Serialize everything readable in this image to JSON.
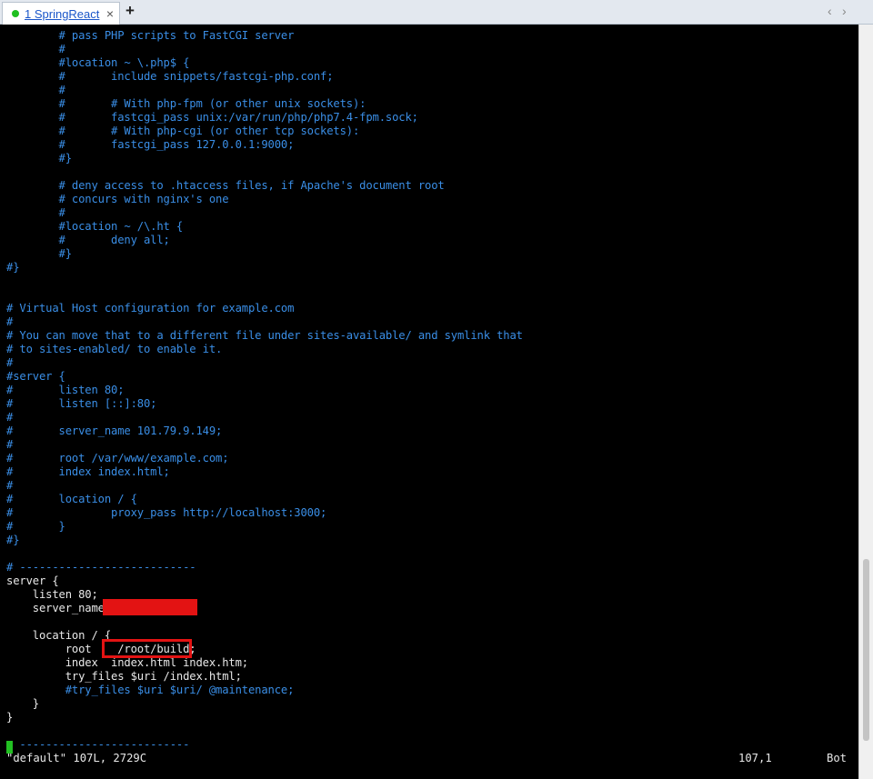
{
  "tab": {
    "label": "1 SpringReact",
    "status_color": "#1fbf1f",
    "close": "×"
  },
  "toolbar": {
    "add": "+",
    "prev": "‹",
    "next": "›"
  },
  "lines": [
    {
      "text": "        # pass PHP scripts to FastCGI server",
      "style": "c"
    },
    {
      "text": "        #",
      "style": "c"
    },
    {
      "text": "        #location ~ \\.php$ {",
      "style": "c"
    },
    {
      "text": "        #       include snippets/fastcgi-php.conf;",
      "style": "c"
    },
    {
      "text": "        #",
      "style": "c"
    },
    {
      "text": "        #       # With php-fpm (or other unix sockets):",
      "style": "c"
    },
    {
      "text": "        #       fastcgi_pass unix:/var/run/php/php7.4-fpm.sock;",
      "style": "c"
    },
    {
      "text": "        #       # With php-cgi (or other tcp sockets):",
      "style": "c"
    },
    {
      "text": "        #       fastcgi_pass 127.0.0.1:9000;",
      "style": "c"
    },
    {
      "text": "        #}",
      "style": "c"
    },
    {
      "text": "",
      "style": "c"
    },
    {
      "text": "        # deny access to .htaccess files, if Apache's document root",
      "style": "c"
    },
    {
      "text": "        # concurs with nginx's one",
      "style": "c"
    },
    {
      "text": "        #",
      "style": "c"
    },
    {
      "text": "        #location ~ /\\.ht {",
      "style": "c"
    },
    {
      "text": "        #       deny all;",
      "style": "c"
    },
    {
      "text": "        #}",
      "style": "c"
    },
    {
      "text": "#}",
      "style": "c"
    },
    {
      "text": "",
      "style": "c"
    },
    {
      "text": "",
      "style": "c"
    },
    {
      "text": "# Virtual Host configuration for example.com",
      "style": "c"
    },
    {
      "text": "#",
      "style": "c"
    },
    {
      "text": "# You can move that to a different file under sites-available/ and symlink that",
      "style": "c"
    },
    {
      "text": "# to sites-enabled/ to enable it.",
      "style": "c"
    },
    {
      "text": "#",
      "style": "c"
    },
    {
      "text": "#server {",
      "style": "c"
    },
    {
      "text": "#       listen 80;",
      "style": "c"
    },
    {
      "text": "#       listen [::]:80;",
      "style": "c"
    },
    {
      "text": "#",
      "style": "c"
    },
    {
      "text": "#       server_name 101.79.9.149;",
      "style": "c"
    },
    {
      "text": "#",
      "style": "c"
    },
    {
      "text": "#       root /var/www/example.com;",
      "style": "c"
    },
    {
      "text": "#       index index.html;",
      "style": "c"
    },
    {
      "text": "#",
      "style": "c"
    },
    {
      "text": "#       location / {",
      "style": "c"
    },
    {
      "text": "#               proxy_pass http://localhost:3000;",
      "style": "c"
    },
    {
      "text": "#       }",
      "style": "c"
    },
    {
      "text": "#}",
      "style": "c"
    },
    {
      "text": "",
      "style": "c"
    },
    {
      "text": "# ---------------------------",
      "style": "c"
    },
    {
      "text": "server {",
      "style": "w"
    },
    {
      "text": "    listen 80;",
      "style": "w"
    },
    {
      "text": "    server_name",
      "style": "w"
    },
    {
      "text": "",
      "style": "w"
    },
    {
      "text": "    location / {",
      "style": "w"
    },
    {
      "text": "         root    /root/build;",
      "style": "w"
    },
    {
      "text": "         index  index.html index.htm;",
      "style": "w"
    },
    {
      "text": "         try_files $uri /index.html;",
      "style": "w"
    },
    {
      "text": "         #try_files $uri $uri/ @maintenance;",
      "style": "c"
    },
    {
      "text": "    }",
      "style": "w"
    },
    {
      "text": "}",
      "style": "w"
    },
    {
      "text": "",
      "style": "w"
    },
    {
      "text": "  --------------------------",
      "style": "c"
    }
  ],
  "status": {
    "left": "\"default\" 107L, 2729C",
    "position": "107,1",
    "scroll": "Bot"
  },
  "colors": {
    "comment": "#3a8ee6",
    "text": "#e8e8e8",
    "highlight": "#e31313",
    "cursor": "#22c022"
  }
}
